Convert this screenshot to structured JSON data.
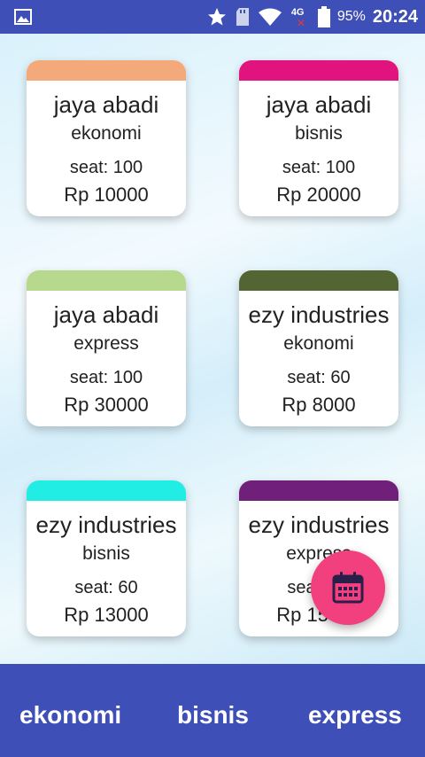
{
  "status_bar": {
    "battery": "95%",
    "time": "20:24",
    "network": "4G"
  },
  "cards": [
    {
      "name": "jaya abadi",
      "class": "ekonomi",
      "seat": "seat: 100",
      "price": "Rp 10000",
      "color": "#f4a97a"
    },
    {
      "name": "jaya abadi",
      "class": "bisnis",
      "seat": "seat: 100",
      "price": "Rp 20000",
      "color": "#e0137f"
    },
    {
      "name": "jaya abadi",
      "class": "express",
      "seat": "seat: 100",
      "price": "Rp 30000",
      "color": "#b6d98d"
    },
    {
      "name": "ezy industries",
      "class": "ekonomi",
      "seat": "seat: 60",
      "price": "Rp 8000",
      "color": "#536532"
    },
    {
      "name": "ezy industries",
      "class": "bisnis",
      "seat": "seat: 60",
      "price": "Rp 13000",
      "color": "#22ede4"
    },
    {
      "name": "ezy industries",
      "class": "express",
      "seat": "seat: 60",
      "price": "Rp 15000",
      "color": "#701f7b"
    }
  ],
  "fab": {
    "icon": "calendar-icon"
  },
  "tabs": {
    "ekonomi": "ekonomi",
    "bisnis": "bisnis",
    "express": "express"
  },
  "colors": {
    "primary": "#3e4fb7",
    "accent": "#f23f7d"
  }
}
